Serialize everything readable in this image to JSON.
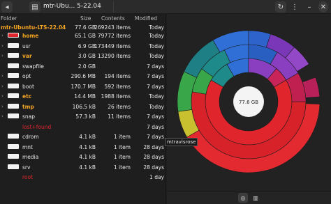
{
  "titlebar": {
    "title": "mtr-Ubu... 5-22.04"
  },
  "columns": {
    "name": "Folder",
    "size": "Size",
    "contents": "Contents",
    "modified": "Modified"
  },
  "root": {
    "name": "mtr-Ubuntu-LTS-22.04",
    "size": "77.6 GB",
    "contents": "269243 items",
    "modified": "Today"
  },
  "rows": [
    {
      "name": "home",
      "size": "65.1 GB",
      "contents": "79772 items",
      "modified": "Today"
    },
    {
      "name": "usr",
      "size": "6.9 GB",
      "contents": "173449 items",
      "modified": "Today"
    },
    {
      "name": "var",
      "size": "3.0 GB",
      "contents": "13290 items",
      "modified": "Today"
    },
    {
      "name": "swapfile",
      "size": "2.0 GB",
      "contents": "",
      "modified": "7 days"
    },
    {
      "name": "opt",
      "size": "290.6 MB",
      "contents": "194 items",
      "modified": "7 days"
    },
    {
      "name": "boot",
      "size": "170.7 MB",
      "contents": "592 items",
      "modified": "7 days"
    },
    {
      "name": "etc",
      "size": "14.4 MB",
      "contents": "1988 items",
      "modified": "Today"
    },
    {
      "name": "tmp",
      "size": "106.5 kB",
      "contents": "26 items",
      "modified": "Today"
    },
    {
      "name": "snap",
      "size": "57.3 kB",
      "contents": "11 items",
      "modified": "7 days"
    },
    {
      "name": "lost+found",
      "size": "",
      "contents": "",
      "modified": "7 days"
    },
    {
      "name": "cdrom",
      "size": "4.1 kB",
      "contents": "1 item",
      "modified": "7 days"
    },
    {
      "name": "mnt",
      "size": "4.1 kB",
      "contents": "1 item",
      "modified": "28 days"
    },
    {
      "name": "media",
      "size": "4.1 kB",
      "contents": "1 item",
      "modified": "28 days"
    },
    {
      "name": "srv",
      "size": "4.1 kB",
      "contents": "1 item",
      "modified": "28 days"
    },
    {
      "name": "root",
      "size": "",
      "contents": "",
      "modified": "1 day"
    }
  ],
  "chart": {
    "center_label": "77.6 GB",
    "tooltip": "mtravisrose"
  },
  "colors": {
    "accent_orange": "#f5a623",
    "accent_red": "#e0252c",
    "ring_red": "#e0252c",
    "ring_blue": "#2f6fd6",
    "ring_teal": "#1f8a8a",
    "ring_green": "#3aa64a",
    "ring_yellow": "#c9c030",
    "ring_purple": "#8a3fc0",
    "ring_pink": "#c8245a"
  }
}
